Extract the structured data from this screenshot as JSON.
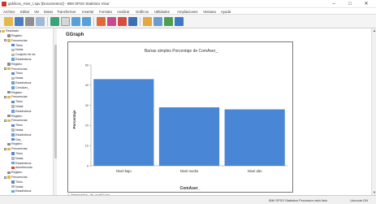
{
  "window": {
    "title": "gráficos_Aser_I.spv [Documento2] - IBM SPSS Statistics Visor",
    "minimize": "–",
    "maximize": "□",
    "close": "✕"
  },
  "menubar": {
    "items": [
      "Archivo",
      "Editar",
      "Ver",
      "Datos",
      "Transformar",
      "Insertar",
      "Formato",
      "Analizar",
      "Gráficos",
      "Utilidades",
      "Ampliaciones",
      "Ventana",
      "Ayuda"
    ]
  },
  "toolbar": {
    "icons": [
      "open-icon",
      "save-icon",
      "print-icon",
      "print-preview-icon",
      "export-icon",
      "recall-dialog-icon",
      "undo-icon",
      "redo-icon",
      "goto-data-icon",
      "goto-case-icon",
      "variables-icon",
      "show-all-icon",
      "insert-output-icon",
      "insert-title-icon",
      "insert-text-icon",
      "designate-window-icon"
    ]
  },
  "nav": {
    "items": [
      {
        "label": "Resultado",
        "icon": "folder",
        "level": 0
      },
      {
        "label": "Registro",
        "icon": "log",
        "level": 1
      },
      {
        "label": "Frecuencias",
        "icon": "folder",
        "level": 1
      },
      {
        "label": "Título",
        "icon": "title",
        "level": 2
      },
      {
        "label": "Notas",
        "icon": "notes",
        "level": 2
      },
      {
        "label": "Conjunto de da",
        "icon": "notes",
        "level": 2
      },
      {
        "label": "Estadísticos",
        "icon": "table",
        "level": 2
      },
      {
        "label": "Registro",
        "icon": "log",
        "level": 1
      },
      {
        "label": "Frecuencias",
        "icon": "folder",
        "level": 1
      },
      {
        "label": "Título",
        "icon": "title",
        "level": 2
      },
      {
        "label": "Notas",
        "icon": "notes",
        "level": 2
      },
      {
        "label": "Estadísticos",
        "icon": "table",
        "level": 2
      },
      {
        "label": "ComAser_",
        "icon": "table",
        "level": 2
      },
      {
        "label": "Registro",
        "icon": "log",
        "level": 1
      },
      {
        "label": "Frecuencias",
        "icon": "folder",
        "level": 1
      },
      {
        "label": "Título",
        "icon": "title",
        "level": 2
      },
      {
        "label": "Notas",
        "icon": "notes",
        "level": 2
      },
      {
        "label": "Estadísticos",
        "icon": "table",
        "level": 2
      },
      {
        "label": "Registro",
        "icon": "log",
        "level": 1
      },
      {
        "label": "Frecuencias",
        "icon": "folder",
        "level": 1
      },
      {
        "label": "Título",
        "icon": "title",
        "level": 2
      },
      {
        "label": "Notas",
        "icon": "notes",
        "level": 2
      },
      {
        "label": "Estadísticos",
        "icon": "table",
        "level": 2
      },
      {
        "label": "Gra_",
        "icon": "chart",
        "level": 2
      },
      {
        "label": "Registro",
        "icon": "log",
        "level": 1
      },
      {
        "label": "Frecuencias",
        "icon": "folder",
        "level": 1
      },
      {
        "label": "Título",
        "icon": "title",
        "level": 2
      },
      {
        "label": "Notas",
        "icon": "notes",
        "level": 2
      },
      {
        "label": "Estadísticos",
        "icon": "table",
        "level": 2
      },
      {
        "label": "Advertencias",
        "icon": "warn",
        "level": 2
      },
      {
        "label": "Registro",
        "icon": "log",
        "level": 1
      },
      {
        "label": "Frecuencias",
        "icon": "folder",
        "level": 1
      },
      {
        "label": "Título",
        "icon": "title",
        "level": 2
      },
      {
        "label": "Notas",
        "icon": "notes",
        "level": 2
      },
      {
        "label": "Estadísticos",
        "icon": "table",
        "level": 2
      }
    ]
  },
  "content": {
    "heading": "GGraph",
    "footnote": "* Generador de gráficos."
  },
  "chart_data": {
    "type": "bar",
    "title": "Barras simples Porcentaje de ComAser_",
    "xlabel": "ComAser_",
    "ylabel": "Porcentaje",
    "categories": [
      "Nivel bajo",
      "Nivel medio",
      "Nivel alto"
    ],
    "values": [
      43,
      29,
      28
    ],
    "ylim": [
      0,
      50
    ],
    "yticks": [
      0,
      10,
      20,
      30,
      40,
      50
    ],
    "bar_color": "#4a86d6"
  },
  "status": {
    "processor": "IBM SPSS Statistics Processor está listo",
    "unicode": "Unicode:ON"
  },
  "colors": {
    "toolbar_bg": "#f4f4f4",
    "bar": "#4a86d6"
  }
}
